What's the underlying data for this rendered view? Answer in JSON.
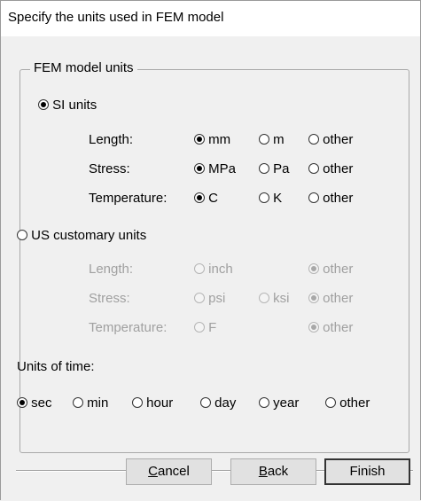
{
  "dialog": {
    "title": "Specify the units used in FEM model"
  },
  "group": {
    "legend": "FEM model units"
  },
  "si": {
    "label": "SI units",
    "selected": true,
    "length": {
      "label": "Length:",
      "options": [
        "mm",
        "m",
        "other"
      ],
      "selected": "mm"
    },
    "stress": {
      "label": "Stress:",
      "options": [
        "MPa",
        "Pa",
        "other"
      ],
      "selected": "MPa"
    },
    "temperature": {
      "label": "Temperature:",
      "options": [
        "C",
        "K",
        "other"
      ],
      "selected": "C"
    }
  },
  "us": {
    "label": "US customary units",
    "selected": false,
    "length": {
      "label": "Length:",
      "options": [
        "inch",
        "other"
      ],
      "selected": "other"
    },
    "stress": {
      "label": "Stress:",
      "options": [
        "psi",
        "ksi",
        "other"
      ],
      "selected": "other"
    },
    "temperature": {
      "label": "Temperature:",
      "options": [
        "F",
        "other"
      ],
      "selected": "other"
    }
  },
  "time": {
    "label": "Units of time:",
    "options": [
      "sec",
      "min",
      "hour",
      "day",
      "year",
      "other"
    ],
    "selected": "sec"
  },
  "buttons": {
    "cancel": {
      "mnemonic": "C",
      "rest": "ancel"
    },
    "back": {
      "mnemonic": "B",
      "rest": "ack"
    },
    "finish": "Finish"
  }
}
